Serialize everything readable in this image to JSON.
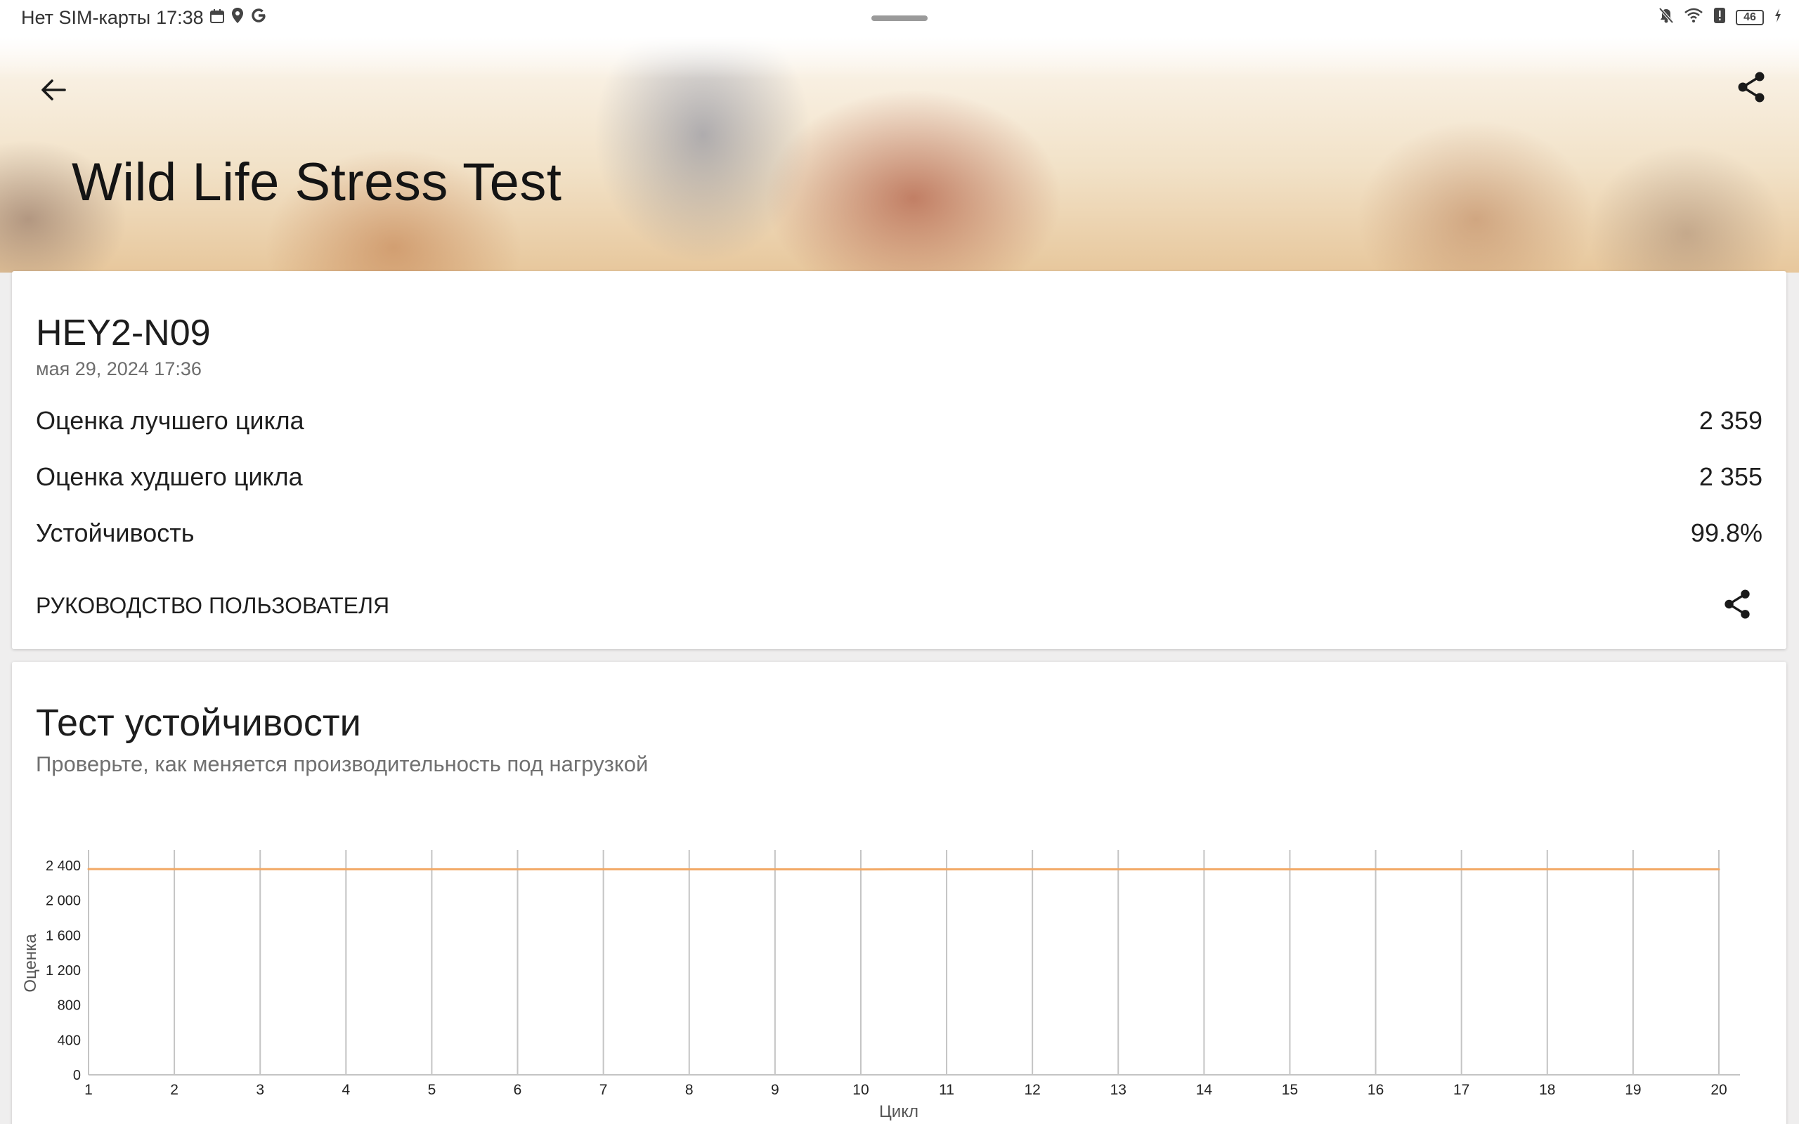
{
  "status_bar": {
    "carrier": "Нет SIM-карты",
    "time": "17:38",
    "battery": "46"
  },
  "header": {
    "title": "Wild Life Stress Test"
  },
  "result": {
    "device": "HEY2-N09",
    "date": "мая 29, 2024 17:36",
    "rows": [
      {
        "label": "Оценка лучшего цикла",
        "value": "2 359"
      },
      {
        "label": "Оценка худшего цикла",
        "value": "2 355"
      },
      {
        "label": "Устойчивость",
        "value": "99.8%"
      }
    ],
    "guide_label": "РУКОВОДСТВО ПОЛЬЗОВАТЕЛЯ"
  },
  "stability": {
    "title": "Тест устойчивости",
    "subtitle": "Проверьте, как меняется производительность под нагрузкой"
  },
  "colors": {
    "line": "#f2a966",
    "grid": "#c4c4c4"
  },
  "chart_data": {
    "type": "line",
    "xlabel": "Цикл",
    "ylabel": "Оценка",
    "x": [
      1,
      2,
      3,
      4,
      5,
      6,
      7,
      8,
      9,
      10,
      11,
      12,
      13,
      14,
      15,
      16,
      17,
      18,
      19,
      20
    ],
    "series": [
      {
        "values": [
          2359,
          2358,
          2358,
          2357,
          2357,
          2356,
          2357,
          2356,
          2356,
          2355,
          2356,
          2357,
          2356,
          2357,
          2356,
          2356,
          2356,
          2357,
          2356,
          2356
        ]
      }
    ],
    "yticks": [
      "0",
      "400",
      "800",
      "1 200",
      "1 600",
      "2 000",
      "2 400"
    ],
    "xticks": [
      "1",
      "2",
      "3",
      "4",
      "5",
      "6",
      "7",
      "8",
      "9",
      "10",
      "11",
      "12",
      "13",
      "14",
      "15",
      "16",
      "17",
      "18",
      "19",
      "20"
    ],
    "xlim": [
      1,
      20
    ],
    "ylim": [
      0,
      2400
    ],
    "grid": "vertical"
  }
}
